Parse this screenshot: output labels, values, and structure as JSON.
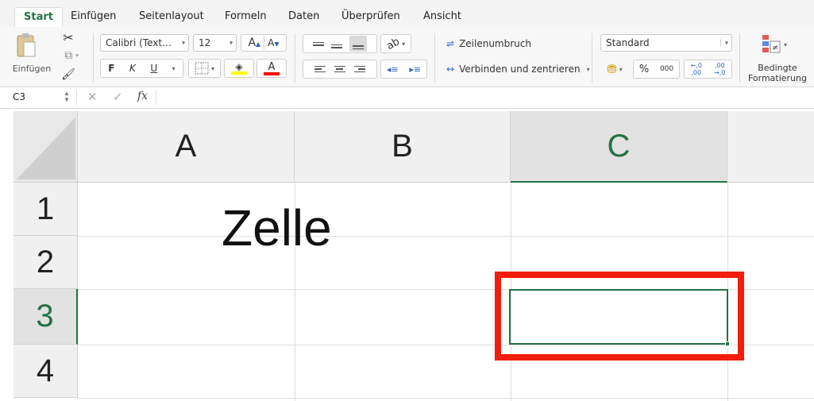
{
  "tabs": [
    "Start",
    "Einfügen",
    "Seitenlayout",
    "Formeln",
    "Daten",
    "Überprüfen",
    "Ansicht"
  ],
  "ribbon": {
    "paste_label": "Einfügen",
    "font_name": "Calibri (Text…",
    "font_size": "12",
    "bold_label": "F",
    "italic_label": "K",
    "underline_label": "U",
    "wrap_text_label": "Zeilenumbruch",
    "merge_label": "Verbinden und zentrieren",
    "number_format": "Standard",
    "percent_label": "%",
    "thousands_label": "000",
    "cond_format_label_1": "Bedingte",
    "cond_format_label_2": "Formatierung",
    "highlight_color": "#ffff00",
    "font_color": "#ff0000"
  },
  "formula_bar": {
    "name_box": "C3",
    "fx_label": "fx",
    "formula": ""
  },
  "grid": {
    "columns": [
      "A",
      "B",
      "C"
    ],
    "rows": [
      "1",
      "2",
      "3",
      "4"
    ],
    "selected_column": "C",
    "selected_row": "3",
    "cell_text": "Zelle"
  },
  "colors": {
    "accent": "#217346",
    "highlight_box": "#f21d0c"
  }
}
